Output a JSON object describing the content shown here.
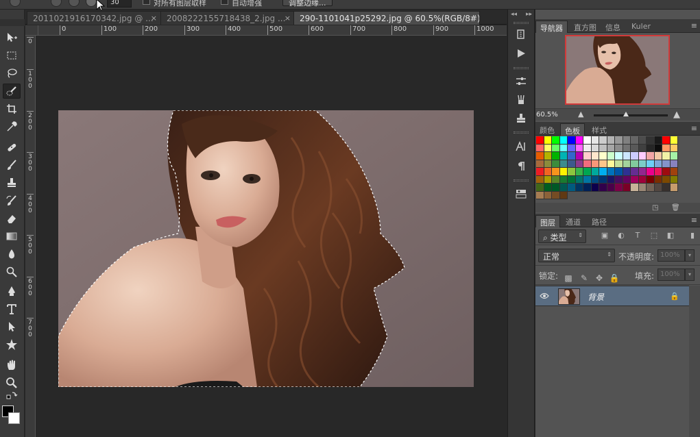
{
  "options_bar": {
    "size_value": "30",
    "sample_all_layers_label": "对所有图层取样",
    "auto_enhance_label": "自动增强",
    "refine_edge_label": "调整边缘..."
  },
  "document_tabs": [
    {
      "label": "2011021916170342.jpg @ ...",
      "close": "×"
    },
    {
      "label": "2008222155718438_2.jpg ...",
      "close": "×"
    },
    {
      "label": "290-1101041p25292.jpg @ 60.5%(RGB/8#)",
      "close": "×"
    }
  ],
  "ruler": {
    "horizontal": [
      "0",
      "100",
      "200",
      "300",
      "400",
      "500",
      "600",
      "700",
      "800",
      "900",
      "1000"
    ],
    "vertical": [
      "0",
      "100",
      "200",
      "300",
      "400",
      "500",
      "600",
      "700"
    ]
  },
  "panels": {
    "navigator_tabs": [
      "导航器",
      "直方图",
      "信息",
      "Kuler"
    ],
    "zoom_value": "60.5%",
    "color_tabs": [
      "颜色",
      "色板",
      "样式"
    ],
    "layers_tabs": [
      "图层",
      "通道",
      "路径"
    ],
    "filter_kind_label": "类型",
    "blend_mode": "正常",
    "opacity_label": "不透明度:",
    "opacity_value": "100%",
    "lock_label": "锁定:",
    "fill_label": "填充:",
    "fill_value": "100%",
    "layer_name": "背景",
    "menu_icon": "≡"
  },
  "swatches": [
    "#ff0000",
    "#ffff00",
    "#00ff00",
    "#00ffff",
    "#0000ff",
    "#ff00ff",
    "#ffffff",
    "#e6e6e6",
    "#cccccc",
    "#b3b3b3",
    "#999999",
    "#808080",
    "#666666",
    "#4d4d4d",
    "#333333",
    "#1a1a1a",
    "#ff0000",
    "#ffff33",
    "#ff6666",
    "#ffff66",
    "#66ff66",
    "#66ffff",
    "#6666ff",
    "#ff66ff",
    "#eeeeee",
    "#d9d9d9",
    "#bfbfbf",
    "#a6a6a6",
    "#8c8c8c",
    "#737373",
    "#595959",
    "#404040",
    "#262626",
    "#0d0d0d",
    "#ff9966",
    "#ffcc66",
    "#e65c00",
    "#b3b300",
    "#00b300",
    "#00b3b3",
    "#3366cc",
    "#b300b3",
    "#ffcccc",
    "#ffe6cc",
    "#ffffcc",
    "#ccffcc",
    "#ccffff",
    "#cce6ff",
    "#ccccff",
    "#ffccff",
    "#f2a6a6",
    "#f2c9a6",
    "#f2f2a6",
    "#a6f2a6",
    "#a66a3c",
    "#8c8c3c",
    "#3c8c3c",
    "#3c8c8c",
    "#3c5a8c",
    "#8c3c8c",
    "#f26d7d",
    "#f7977a",
    "#fdc68a",
    "#fff79a",
    "#c4df9b",
    "#a3d39c",
    "#82ca9d",
    "#7bcdc8",
    "#6ecff6",
    "#7ea7d8",
    "#8493ca",
    "#8882be",
    "#ed1c24",
    "#f26522",
    "#f7941d",
    "#fff200",
    "#8dc63f",
    "#39b54a",
    "#00a651",
    "#00a99d",
    "#00aeef",
    "#0072bc",
    "#0054a6",
    "#2e3192",
    "#662d91",
    "#92278f",
    "#ec008c",
    "#ed145b",
    "#9e0b0f",
    "#a0410d",
    "#a3620a",
    "#aba000",
    "#598527",
    "#1a7b30",
    "#007236",
    "#00746b",
    "#0076a3",
    "#004b80",
    "#003471",
    "#1b1464",
    "#440e62",
    "#630460",
    "#9e005d",
    "#9e0039",
    "#790000",
    "#7b2e00",
    "#7d4900",
    "#827b00",
    "#406618",
    "#005e20",
    "#005826",
    "#005952",
    "#005b7f",
    "#003663",
    "#002157",
    "#0d004c",
    "#32004b",
    "#4b0049",
    "#7b0046",
    "#7a0026",
    "#c7b299",
    "#998675",
    "#736357",
    "#534741",
    "#37302d",
    "#c69c6d",
    "#a67c52",
    "#8c6239",
    "#754c24",
    "#603913"
  ]
}
